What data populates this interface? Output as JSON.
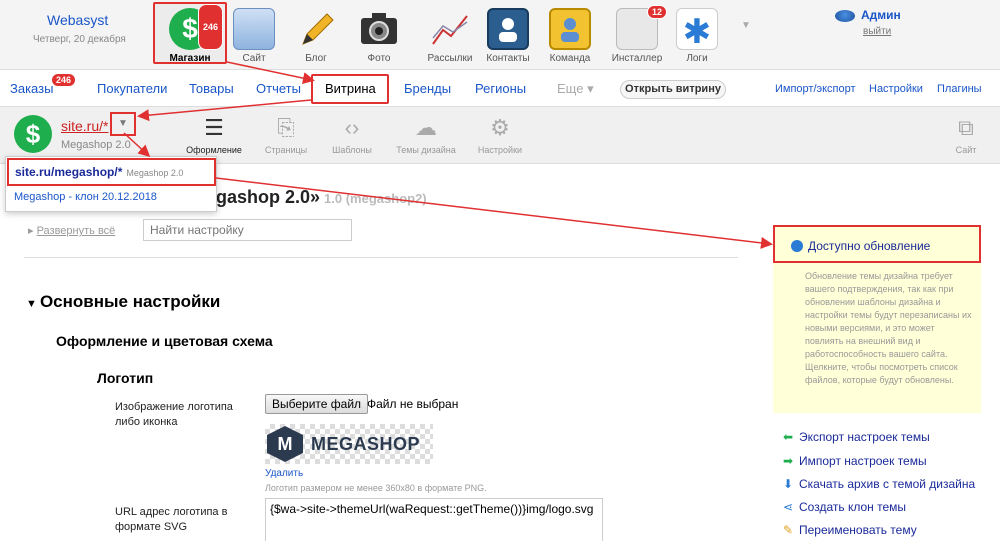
{
  "appbar": {
    "brand": "Webasyst",
    "date": "Четверг, 20 декабря",
    "apps": [
      {
        "label": "Магазин",
        "badge": "246"
      },
      {
        "label": "Сайт"
      },
      {
        "label": "Блог"
      },
      {
        "label": "Фото"
      },
      {
        "label": "Рассылки"
      },
      {
        "label": "Контакты"
      },
      {
        "label": "Команда"
      },
      {
        "label": "Инсталлер",
        "badge": "12"
      },
      {
        "label": "Логи"
      }
    ],
    "user": {
      "name": "Админ",
      "logout": "выйти"
    }
  },
  "nav": {
    "orders": "Заказы",
    "orders_badge": "246",
    "customers": "Покупатели",
    "products": "Товары",
    "reports": "Отчеты",
    "storefront": "Витрина",
    "brands": "Бренды",
    "regions": "Регионы",
    "more": "Еще ▾",
    "open_storefront": "Открыть витрину",
    "import_export": "Импорт/экспорт",
    "settings": "Настройки",
    "plugins": "Плагины"
  },
  "toolbar": {
    "site_name": "site.ru/*",
    "theme_name": "Megashop 2.0",
    "caret": "▼",
    "tools": {
      "design": "Оформление",
      "pages": "Страницы",
      "templates": "Шаблоны",
      "themes": "Темы дизайна",
      "settings": "Настройки",
      "site": "Сайт"
    }
  },
  "dropdown": {
    "item1_route": "site.ru/megashop/*",
    "item1_theme": "Megashop 2.0",
    "item2": "Megashop - клон 20.12.2018"
  },
  "content": {
    "title": "gashop 2.0»",
    "version": "1.0 (megashop2)",
    "expand_all": "Развернуть всё",
    "search_placeholder": "Найти настройку",
    "section_main": "Основные настройки",
    "section_colors": "Оформление и цветовая схема",
    "section_logo": "Логотип",
    "logo_image_label": "Изображение логотипа либо иконка",
    "choose_file": "Выберите файл",
    "no_file": "Файл не выбран",
    "logo_letter": "M",
    "logo_wordmark": "MEGASHOP",
    "delete": "Удалить",
    "logo_hint": "Логотип размером не менее 360x80 в формате PNG.",
    "svg_url_label": "URL адрес логотипа в формате SVG",
    "svg_url_value": "{$wa->site->themeUrl(waRequest::getTheme())}img/logo.svg"
  },
  "update": {
    "title": "Доступно обновление",
    "description": "Обновление темы дизайна требует вашего подтверждения, так как при обновлении шаблоны дизайна и настройки темы будут перезаписаны их новыми версиями, и это может повлиять на внешний вид и работоспособность вашего сайта. Щелкните, чтобы посмотреть список файлов, которые будут обновлены."
  },
  "actions": [
    {
      "label": "Экспорт настроек темы",
      "icon": "arrow-left-icon",
      "color": "#1fae4e"
    },
    {
      "label": "Импорт настроек темы",
      "icon": "arrow-right-icon",
      "color": "#1fae4e"
    },
    {
      "label": "Скачать архив с темой дизайна",
      "icon": "arrow-down-icon",
      "color": "#2a7bd6"
    },
    {
      "label": "Создать клон темы",
      "icon": "share-icon",
      "color": "#2a7bd6"
    },
    {
      "label": "Переименовать тему",
      "icon": "pencil-icon",
      "color": "#e0a020"
    }
  ]
}
